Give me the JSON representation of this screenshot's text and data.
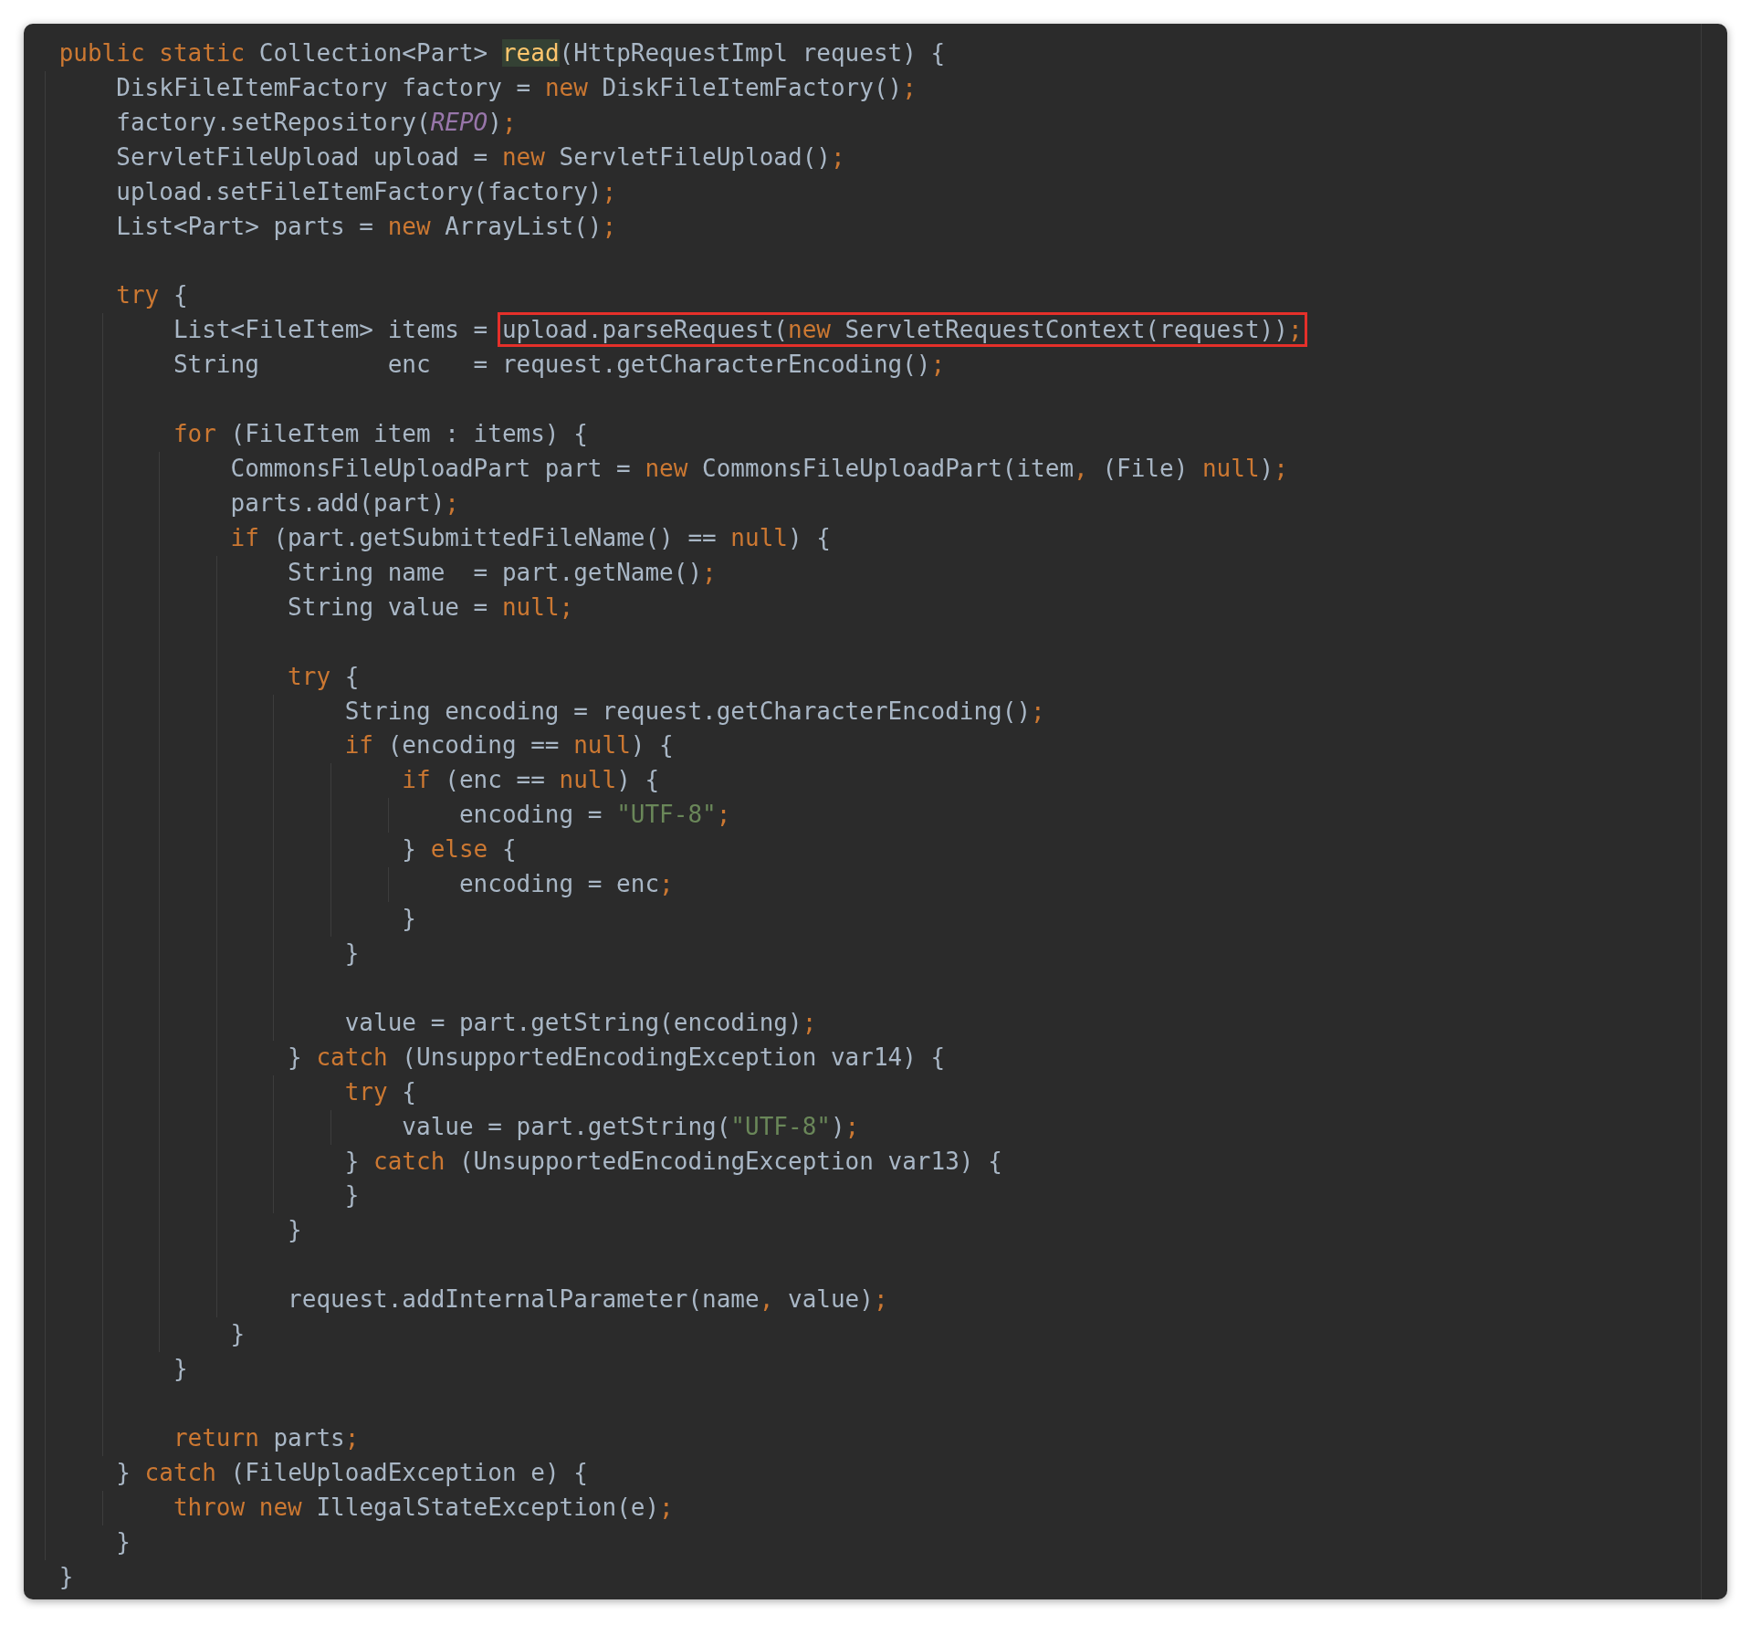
{
  "editor": {
    "lines": [
      {
        "kind": "code",
        "tokens": [
          {
            "t": "public static ",
            "kind": "keyword"
          },
          {
            "t": "Collection<Part> ",
            "kind": "plain"
          },
          {
            "t": "read",
            "kind": "declaration"
          },
          {
            "t": "(HttpRequestImpl request) {",
            "kind": "plain"
          }
        ]
      },
      {
        "kind": "code",
        "tokens": [
          {
            "t": "    DiskFileItemFactory factory = ",
            "kind": "plain"
          },
          {
            "t": "new ",
            "kind": "keyword"
          },
          {
            "t": "DiskFileItemFactory()",
            "kind": "plain"
          },
          {
            "t": ";",
            "kind": "keyword"
          }
        ]
      },
      {
        "kind": "code",
        "tokens": [
          {
            "t": "    factory.setRepository(",
            "kind": "plain"
          },
          {
            "t": "REPO",
            "kind": "constant"
          },
          {
            "t": ")",
            "kind": "plain"
          },
          {
            "t": ";",
            "kind": "keyword"
          }
        ]
      },
      {
        "kind": "code",
        "tokens": [
          {
            "t": "    ServletFileUpload upload = ",
            "kind": "plain"
          },
          {
            "t": "new ",
            "kind": "keyword"
          },
          {
            "t": "ServletFileUpload()",
            "kind": "plain"
          },
          {
            "t": ";",
            "kind": "keyword"
          }
        ]
      },
      {
        "kind": "code",
        "tokens": [
          {
            "t": "    upload.setFileItemFactory(factory)",
            "kind": "plain"
          },
          {
            "t": ";",
            "kind": "keyword"
          }
        ]
      },
      {
        "kind": "code",
        "tokens": [
          {
            "t": "    List<Part> parts = ",
            "kind": "plain"
          },
          {
            "t": "new ",
            "kind": "keyword"
          },
          {
            "t": "ArrayList()",
            "kind": "plain"
          },
          {
            "t": ";",
            "kind": "keyword"
          }
        ]
      },
      {
        "kind": "blank"
      },
      {
        "kind": "code",
        "tokens": [
          {
            "t": "    try",
            "kind": "keyword"
          },
          {
            "t": " {",
            "kind": "plain"
          }
        ]
      },
      {
        "kind": "code",
        "tokens": [
          {
            "t": "        List<FileItem> items = ",
            "kind": "plain"
          },
          {
            "t": "upload.parseRequest(",
            "kind": "plain",
            "boxed": true
          },
          {
            "t": "new ",
            "kind": "keyword",
            "boxed": true
          },
          {
            "t": "ServletRequestContext(request))",
            "kind": "plain",
            "boxed": true
          },
          {
            "t": ";",
            "kind": "keyword",
            "boxed": true
          }
        ]
      },
      {
        "kind": "code",
        "tokens": [
          {
            "t": "        String         enc   = request.getCharacterEncoding()",
            "kind": "plain"
          },
          {
            "t": ";",
            "kind": "keyword"
          }
        ]
      },
      {
        "kind": "blank"
      },
      {
        "kind": "code",
        "tokens": [
          {
            "t": "        for",
            "kind": "keyword"
          },
          {
            "t": " (FileItem item : items) {",
            "kind": "plain"
          }
        ]
      },
      {
        "kind": "code",
        "tokens": [
          {
            "t": "            CommonsFileUploadPart part = ",
            "kind": "plain"
          },
          {
            "t": "new ",
            "kind": "keyword"
          },
          {
            "t": "CommonsFileUploadPart(item",
            "kind": "plain"
          },
          {
            "t": ", ",
            "kind": "keyword"
          },
          {
            "t": "(File) ",
            "kind": "plain"
          },
          {
            "t": "null",
            "kind": "keyword"
          },
          {
            "t": ")",
            "kind": "plain"
          },
          {
            "t": ";",
            "kind": "keyword"
          }
        ]
      },
      {
        "kind": "code",
        "tokens": [
          {
            "t": "            parts.add(part)",
            "kind": "plain"
          },
          {
            "t": ";",
            "kind": "keyword"
          }
        ]
      },
      {
        "kind": "code",
        "tokens": [
          {
            "t": "            if",
            "kind": "keyword"
          },
          {
            "t": " (part.getSubmittedFileName() == ",
            "kind": "plain"
          },
          {
            "t": "null",
            "kind": "keyword"
          },
          {
            "t": ") {",
            "kind": "plain"
          }
        ]
      },
      {
        "kind": "code",
        "tokens": [
          {
            "t": "                String name  = part.getName()",
            "kind": "plain"
          },
          {
            "t": ";",
            "kind": "keyword"
          }
        ]
      },
      {
        "kind": "code",
        "tokens": [
          {
            "t": "                String value = ",
            "kind": "plain"
          },
          {
            "t": "null;",
            "kind": "keyword"
          }
        ]
      },
      {
        "kind": "blank"
      },
      {
        "kind": "code",
        "tokens": [
          {
            "t": "                try",
            "kind": "keyword"
          },
          {
            "t": " {",
            "kind": "plain"
          }
        ]
      },
      {
        "kind": "code",
        "tokens": [
          {
            "t": "                    String encoding = request.getCharacterEncoding()",
            "kind": "plain"
          },
          {
            "t": ";",
            "kind": "keyword"
          }
        ]
      },
      {
        "kind": "code",
        "tokens": [
          {
            "t": "                    if",
            "kind": "keyword"
          },
          {
            "t": " (encoding == ",
            "kind": "plain"
          },
          {
            "t": "null",
            "kind": "keyword"
          },
          {
            "t": ") {",
            "kind": "plain"
          }
        ]
      },
      {
        "kind": "code",
        "tokens": [
          {
            "t": "                        if",
            "kind": "keyword"
          },
          {
            "t": " (enc == ",
            "kind": "plain"
          },
          {
            "t": "null",
            "kind": "keyword"
          },
          {
            "t": ") {",
            "kind": "plain"
          }
        ]
      },
      {
        "kind": "code",
        "tokens": [
          {
            "t": "                            encoding = ",
            "kind": "plain"
          },
          {
            "t": "\"UTF-8\"",
            "kind": "string"
          },
          {
            "t": ";",
            "kind": "keyword"
          }
        ]
      },
      {
        "kind": "code",
        "tokens": [
          {
            "t": "                        } ",
            "kind": "plain"
          },
          {
            "t": "else",
            "kind": "keyword"
          },
          {
            "t": " {",
            "kind": "plain"
          }
        ]
      },
      {
        "kind": "code",
        "tokens": [
          {
            "t": "                            encoding = enc",
            "kind": "plain"
          },
          {
            "t": ";",
            "kind": "keyword"
          }
        ]
      },
      {
        "kind": "code",
        "tokens": [
          {
            "t": "                        }",
            "kind": "plain"
          }
        ]
      },
      {
        "kind": "code",
        "tokens": [
          {
            "t": "                    }",
            "kind": "plain"
          }
        ]
      },
      {
        "kind": "blank"
      },
      {
        "kind": "code",
        "tokens": [
          {
            "t": "                    value = part.getString(encoding)",
            "kind": "plain"
          },
          {
            "t": ";",
            "kind": "keyword"
          }
        ]
      },
      {
        "kind": "code",
        "tokens": [
          {
            "t": "                } ",
            "kind": "plain"
          },
          {
            "t": "catch",
            "kind": "keyword"
          },
          {
            "t": " (UnsupportedEncodingException var14) {",
            "kind": "plain"
          }
        ]
      },
      {
        "kind": "code",
        "tokens": [
          {
            "t": "                    try",
            "kind": "keyword"
          },
          {
            "t": " {",
            "kind": "plain"
          }
        ]
      },
      {
        "kind": "code",
        "tokens": [
          {
            "t": "                        value = part.getString(",
            "kind": "plain"
          },
          {
            "t": "\"UTF-8\"",
            "kind": "string"
          },
          {
            "t": ")",
            "kind": "plain"
          },
          {
            "t": ";",
            "kind": "keyword"
          }
        ]
      },
      {
        "kind": "code",
        "tokens": [
          {
            "t": "                    } ",
            "kind": "plain"
          },
          {
            "t": "catch",
            "kind": "keyword"
          },
          {
            "t": " (UnsupportedEncodingException var13) {",
            "kind": "plain"
          }
        ]
      },
      {
        "kind": "code",
        "tokens": [
          {
            "t": "                    }",
            "kind": "plain"
          }
        ]
      },
      {
        "kind": "code",
        "tokens": [
          {
            "t": "                }",
            "kind": "plain"
          }
        ]
      },
      {
        "kind": "blank"
      },
      {
        "kind": "code",
        "tokens": [
          {
            "t": "                request.addInternalParameter(name",
            "kind": "plain"
          },
          {
            "t": ", ",
            "kind": "keyword"
          },
          {
            "t": "value)",
            "kind": "plain"
          },
          {
            "t": ";",
            "kind": "keyword"
          }
        ]
      },
      {
        "kind": "code",
        "tokens": [
          {
            "t": "            }",
            "kind": "plain"
          }
        ]
      },
      {
        "kind": "code",
        "tokens": [
          {
            "t": "        }",
            "kind": "plain"
          }
        ]
      },
      {
        "kind": "blank"
      },
      {
        "kind": "code",
        "tokens": [
          {
            "t": "        return ",
            "kind": "keyword"
          },
          {
            "t": "parts",
            "kind": "plain"
          },
          {
            "t": ";",
            "kind": "keyword"
          }
        ]
      },
      {
        "kind": "code",
        "tokens": [
          {
            "t": "    } ",
            "kind": "plain"
          },
          {
            "t": "catch",
            "kind": "keyword"
          },
          {
            "t": " (FileUploadException e) {",
            "kind": "plain"
          }
        ]
      },
      {
        "kind": "code",
        "tokens": [
          {
            "t": "        throw new ",
            "kind": "keyword"
          },
          {
            "t": "IllegalStateException(e)",
            "kind": "plain"
          },
          {
            "t": ";",
            "kind": "keyword"
          }
        ]
      },
      {
        "kind": "code",
        "tokens": [
          {
            "t": "    }",
            "kind": "plain"
          }
        ]
      },
      {
        "kind": "code",
        "tokens": [
          {
            "t": "}",
            "kind": "plain"
          }
        ]
      }
    ]
  }
}
